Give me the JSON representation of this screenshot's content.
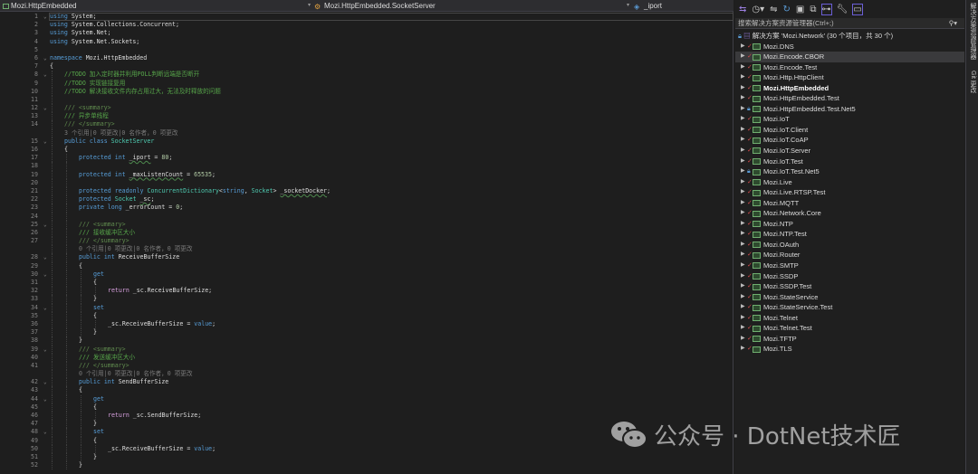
{
  "navbar": {
    "project": "Mozi.HttpEmbedded",
    "type": "Mozi.HttpEmbedded.SocketServer",
    "member": "_iport"
  },
  "code": [
    {
      "n": "1",
      "fold": true,
      "ind": 0,
      "tk": [
        [
          "using",
          "k"
        ],
        " System;"
      ]
    },
    {
      "n": "2",
      "ind": 0,
      "tk": [
        [
          "using",
          "k"
        ],
        " System.Collections.Concurrent;"
      ]
    },
    {
      "n": "3",
      "ind": 0,
      "tk": [
        [
          "using",
          "k"
        ],
        " System.Net;"
      ]
    },
    {
      "n": "4",
      "ind": 0,
      "tk": [
        [
          "using",
          "k"
        ],
        " System.Net.Sockets;"
      ]
    },
    {
      "n": "5",
      "ind": 0,
      "tk": []
    },
    {
      "n": "6",
      "fold": true,
      "ind": 0,
      "tk": [
        [
          "namespace",
          "k"
        ],
        " Mozi.HttpEmbedded"
      ]
    },
    {
      "n": "7",
      "ind": 0,
      "tk": [
        "{"
      ]
    },
    {
      "n": "8",
      "fold": true,
      "ind": 1,
      "tk": [
        [
          "//TODO 加入定时器并利用POLL判断远端是否断开",
          "c"
        ]
      ]
    },
    {
      "n": "9",
      "ind": 1,
      "tk": [
        [
          "//TODO 实现链接复用",
          "c"
        ]
      ]
    },
    {
      "n": "10",
      "ind": 1,
      "tk": [
        [
          "//TODO 解决接收文件内存占用过大，无法及时释放的问题",
          "c"
        ]
      ]
    },
    {
      "n": "11",
      "ind": 1,
      "tk": []
    },
    {
      "n": "12",
      "fold": true,
      "ind": 1,
      "tk": [
        [
          "/// <summary>",
          "x"
        ]
      ]
    },
    {
      "n": "13",
      "ind": 1,
      "tk": [
        [
          "/// 异步单线程",
          "c"
        ]
      ]
    },
    {
      "n": "14",
      "ind": 1,
      "tk": [
        [
          "/// </summary>",
          "x"
        ]
      ]
    },
    {
      "n": "",
      "ind": 1,
      "tk": [
        [
          "3 个引用|0 项更改|0 名作者，0 项更改",
          "g"
        ]
      ]
    },
    {
      "n": "15",
      "fold": true,
      "ind": 1,
      "tk": [
        [
          "public",
          "k"
        ],
        " ",
        [
          "class",
          "k"
        ],
        " ",
        [
          "SocketServer",
          "t"
        ]
      ]
    },
    {
      "n": "16",
      "ind": 1,
      "tk": [
        "{"
      ]
    },
    {
      "n": "17",
      "ind": 2,
      "tk": [
        [
          "protected",
          "k"
        ],
        " ",
        [
          "int",
          "k"
        ],
        " ",
        [
          "_iport",
          "u"
        ],
        " = ",
        [
          "80",
          "n"
        ],
        ";"
      ]
    },
    {
      "n": "18",
      "ind": 2,
      "tk": []
    },
    {
      "n": "19",
      "ind": 2,
      "tk": [
        [
          "protected",
          "k"
        ],
        " ",
        [
          "int",
          "k"
        ],
        " ",
        [
          "_maxListenCount",
          "u"
        ],
        " = ",
        [
          "65535",
          "n"
        ],
        ";"
      ]
    },
    {
      "n": "20",
      "ind": 2,
      "tk": []
    },
    {
      "n": "21",
      "ind": 2,
      "tk": [
        [
          "protected",
          "k"
        ],
        " ",
        [
          "readonly",
          "k"
        ],
        " ",
        [
          "ConcurrentDictionary",
          "t"
        ],
        "<",
        [
          "string",
          "k"
        ],
        ", ",
        [
          "Socket",
          "t"
        ],
        "> ",
        [
          "_socketDocker",
          "u"
        ],
        ";"
      ]
    },
    {
      "n": "22",
      "ind": 2,
      "tk": [
        [
          "protected",
          "k"
        ],
        " ",
        [
          "Socket",
          "t"
        ],
        " ",
        [
          "_sc",
          "u"
        ],
        ";"
      ]
    },
    {
      "n": "23",
      "ind": 2,
      "tk": [
        [
          "private",
          "k"
        ],
        " ",
        [
          "long",
          "k"
        ],
        " _errorCount = ",
        [
          "0",
          "n"
        ],
        ";"
      ]
    },
    {
      "n": "24",
      "ind": 2,
      "tk": []
    },
    {
      "n": "25",
      "fold": true,
      "ind": 2,
      "tk": [
        [
          "/// <summary>",
          "x"
        ]
      ]
    },
    {
      "n": "26",
      "ind": 2,
      "tk": [
        [
          "/// 接收缓冲区大小",
          "c"
        ]
      ]
    },
    {
      "n": "27",
      "ind": 2,
      "tk": [
        [
          "/// </summary>",
          "x"
        ]
      ]
    },
    {
      "n": "",
      "ind": 2,
      "tk": [
        [
          "0 个引用|0 项更改|0 名作者，0 项更改",
          "g"
        ]
      ]
    },
    {
      "n": "28",
      "fold": true,
      "ind": 2,
      "tk": [
        [
          "public",
          "k"
        ],
        " ",
        [
          "int",
          "k"
        ],
        " ReceiveBufferSize"
      ]
    },
    {
      "n": "29",
      "ind": 2,
      "tk": [
        "{"
      ]
    },
    {
      "n": "30",
      "fold": true,
      "ind": 3,
      "tk": [
        [
          "get",
          "k"
        ]
      ]
    },
    {
      "n": "31",
      "ind": 3,
      "tk": [
        "{"
      ]
    },
    {
      "n": "32",
      "ind": 4,
      "tk": [
        [
          "return",
          "r"
        ],
        " _sc.ReceiveBufferSize;"
      ]
    },
    {
      "n": "33",
      "ind": 3,
      "tk": [
        "}"
      ]
    },
    {
      "n": "34",
      "fold": true,
      "ind": 3,
      "tk": [
        [
          "set",
          "k"
        ]
      ]
    },
    {
      "n": "35",
      "ind": 3,
      "tk": [
        "{"
      ]
    },
    {
      "n": "36",
      "ind": 4,
      "tk": [
        "_sc.ReceiveBufferSize = ",
        [
          "value",
          "k"
        ],
        ";"
      ]
    },
    {
      "n": "37",
      "ind": 3,
      "tk": [
        "}"
      ]
    },
    {
      "n": "38",
      "ind": 2,
      "tk": [
        "}"
      ]
    },
    {
      "n": "39",
      "fold": true,
      "ind": 2,
      "tk": [
        [
          "/// <summary>",
          "x"
        ]
      ]
    },
    {
      "n": "40",
      "ind": 2,
      "tk": [
        [
          "/// 发送缓冲区大小",
          "c"
        ]
      ]
    },
    {
      "n": "41",
      "ind": 2,
      "tk": [
        [
          "/// </summary>",
          "x"
        ]
      ]
    },
    {
      "n": "",
      "ind": 2,
      "tk": [
        [
          "0 个引用|0 项更改|0 名作者，0 项更改",
          "g"
        ]
      ]
    },
    {
      "n": "42",
      "fold": true,
      "ind": 2,
      "tk": [
        [
          "public",
          "k"
        ],
        " ",
        [
          "int",
          "k"
        ],
        " SendBufferSize"
      ]
    },
    {
      "n": "43",
      "ind": 2,
      "tk": [
        "{"
      ]
    },
    {
      "n": "44",
      "fold": true,
      "ind": 3,
      "tk": [
        [
          "get",
          "k"
        ]
      ]
    },
    {
      "n": "45",
      "ind": 3,
      "tk": [
        "{"
      ]
    },
    {
      "n": "46",
      "ind": 4,
      "tk": [
        [
          "return",
          "r"
        ],
        " _sc.SendBufferSize;"
      ]
    },
    {
      "n": "47",
      "ind": 3,
      "tk": [
        "}"
      ]
    },
    {
      "n": "48",
      "fold": true,
      "ind": 3,
      "tk": [
        [
          "set",
          "k"
        ]
      ]
    },
    {
      "n": "49",
      "ind": 3,
      "tk": [
        "{"
      ]
    },
    {
      "n": "50",
      "ind": 4,
      "tk": [
        "_sc.ReceiveBufferSize = ",
        [
          "value",
          "k"
        ],
        ";"
      ]
    },
    {
      "n": "51",
      "ind": 3,
      "tk": [
        "}"
      ]
    },
    {
      "n": "52",
      "ind": 2,
      "tk": [
        "}"
      ]
    }
  ],
  "solution": {
    "search_placeholder": "搜索解决方案资源管理器(Ctrl+;)",
    "root": "解决方案 'Mozi.Network' (30 个项目，共 30 个)",
    "items": [
      {
        "name": "Mozi.DNS"
      },
      {
        "name": "Mozi.Encode.CBOR",
        "selected": true
      },
      {
        "name": "Mozi.Encode.Test"
      },
      {
        "name": "Mozi.Http.HttpClient"
      },
      {
        "name": "Mozi.HttpEmbedded",
        "bold": true
      },
      {
        "name": "Mozi.HttpEmbedded.Test"
      },
      {
        "name": "Mozi.HttpEmbedded.Test.Net5",
        "lock": true
      },
      {
        "name": "Mozi.IoT"
      },
      {
        "name": "Mozi.IoT.Client"
      },
      {
        "name": "Mozi.IoT.CoAP"
      },
      {
        "name": "Mozi.IoT.Server"
      },
      {
        "name": "Mozi.IoT.Test"
      },
      {
        "name": "Mozi.IoT.Test.Net5",
        "lock": true
      },
      {
        "name": "Mozi.Live"
      },
      {
        "name": "Mozi.Live.RTSP.Test"
      },
      {
        "name": "Mozi.MQTT"
      },
      {
        "name": "Mozi.Network.Core"
      },
      {
        "name": "Mozi.NTP"
      },
      {
        "name": "Mozi.NTP.Test"
      },
      {
        "name": "Mozi.OAuth"
      },
      {
        "name": "Mozi.Router"
      },
      {
        "name": "Mozi.SMTP"
      },
      {
        "name": "Mozi.SSDP"
      },
      {
        "name": "Mozi.SSDP.Test"
      },
      {
        "name": "Mozi.StateService"
      },
      {
        "name": "Mozi.StateService.Test"
      },
      {
        "name": "Mozi.Telnet"
      },
      {
        "name": "Mozi.Telnet.Test"
      },
      {
        "name": "Mozi.TFTP"
      },
      {
        "name": "Mozi.TLS"
      }
    ]
  },
  "side_tabs": [
    "解决方案资源管理器",
    "Git 更改"
  ],
  "watermark": {
    "text": "公众号 · DotNet技术匠"
  }
}
